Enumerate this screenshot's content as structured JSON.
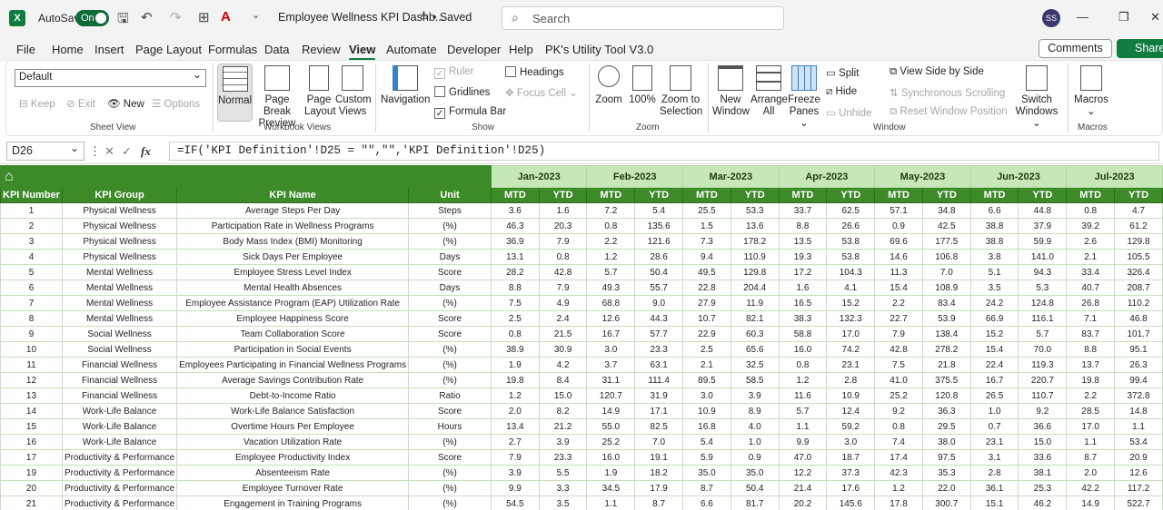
{
  "titlebar": {
    "app_logo": "X",
    "autosave_label": "AutoSave",
    "autosave_state": "On",
    "doc_title": "Employee Wellness KPI Dashb...",
    "saved_status": "• Saved",
    "search_placeholder": "Search",
    "user_initials": "SS"
  },
  "menu": {
    "items": [
      "File",
      "Home",
      "Insert",
      "Page Layout",
      "Formulas",
      "Data",
      "Review",
      "View",
      "Automate",
      "Developer",
      "Help",
      "PK's Utility Tool V3.0"
    ],
    "active": "View",
    "comments": "Comments",
    "share": "Share"
  },
  "ribbon": {
    "sheet_view": {
      "dropdown_value": "Default",
      "keep": "Keep",
      "exit": "Exit",
      "new": "New",
      "options": "Options",
      "label": "Sheet View"
    },
    "workbook_views": {
      "normal": "Normal",
      "page_break_1": "Page Break",
      "page_break_2": "Preview",
      "page_layout_1": "Page",
      "page_layout_2": "Layout",
      "custom_1": "Custom",
      "custom_2": "Views",
      "label": "Workbook Views"
    },
    "show": {
      "navigation": "Navigation",
      "ruler": "Ruler",
      "gridlines": "Gridlines",
      "formula_bar": "Formula Bar",
      "headings": "Headings",
      "focus_cell": "Focus Cell",
      "label": "Show"
    },
    "zoom": {
      "zoom": "Zoom",
      "hundred": "100%",
      "sel_1": "Zoom to",
      "sel_2": "Selection",
      "label": "Zoom"
    },
    "window": {
      "new_1": "New",
      "new_2": "Window",
      "arrange_1": "Arrange",
      "arrange_2": "All",
      "freeze_1": "Freeze",
      "freeze_2": "Panes",
      "split": "Split",
      "hide": "Hide",
      "unhide": "Unhide",
      "side_by_side": "View Side by Side",
      "sync_scroll": "Synchronous Scrolling",
      "reset_pos": "Reset Window Position",
      "switch_1": "Switch",
      "switch_2": "Windows",
      "label": "Window"
    },
    "macros": {
      "macros": "Macros",
      "label": "Macros"
    }
  },
  "formula_bar": {
    "cell_ref": "D26",
    "fx": "fx",
    "formula": "=IF('KPI Definition'!D25 = \"\",\"\",'KPI Definition'!D25)"
  },
  "sheet": {
    "months": [
      "Jan-2023",
      "Feb-2023",
      "Mar-2023",
      "Apr-2023",
      "May-2023",
      "Jun-2023",
      "Jul-2023"
    ],
    "headers": [
      "KPI Number",
      "KPI Group",
      "KPI Name",
      "Unit"
    ],
    "sub_headers": [
      "MTD",
      "YTD"
    ],
    "rows": [
      [
        "1",
        "Physical Wellness",
        "Average Steps Per Day",
        "Steps",
        "3.6",
        "1.6",
        "7.2",
        "5.4",
        "25.5",
        "53.3",
        "33.7",
        "62.5",
        "57.1",
        "34.8",
        "6.6",
        "44.8",
        "0.8",
        "4.7"
      ],
      [
        "2",
        "Physical Wellness",
        "Participation Rate in Wellness Programs",
        "(%)",
        "46.3",
        "20.3",
        "0.8",
        "135.6",
        "1.5",
        "13.6",
        "8.8",
        "26.6",
        "0.9",
        "42.5",
        "38.8",
        "37.9",
        "39.2",
        "61.2"
      ],
      [
        "3",
        "Physical Wellness",
        "Body Mass Index (BMI) Monitoring",
        "(%)",
        "36.9",
        "7.9",
        "2.2",
        "121.6",
        "7.3",
        "178.2",
        "13.5",
        "53.8",
        "69.6",
        "177.5",
        "38.8",
        "59.9",
        "2.6",
        "129.8"
      ],
      [
        "4",
        "Physical Wellness",
        "Sick Days Per Employee",
        "Days",
        "13.1",
        "0.8",
        "1.2",
        "28.6",
        "9.4",
        "110.9",
        "19.3",
        "53.8",
        "14.6",
        "106.8",
        "3.8",
        "141.0",
        "2.1",
        "105.5"
      ],
      [
        "5",
        "Mental Wellness",
        "Employee Stress Level Index",
        "Score",
        "28.2",
        "42.8",
        "5.7",
        "50.4",
        "49.5",
        "129.8",
        "17.2",
        "104.3",
        "11.3",
        "7.0",
        "5.1",
        "94.3",
        "33.4",
        "326.4"
      ],
      [
        "6",
        "Mental Wellness",
        "Mental Health Absences",
        "Days",
        "8.8",
        "7.9",
        "49.3",
        "55.7",
        "22.8",
        "204.4",
        "1.6",
        "4.1",
        "15.4",
        "108.9",
        "3.5",
        "5.3",
        "40.7",
        "208.7"
      ],
      [
        "7",
        "Mental Wellness",
        "Employee Assistance Program (EAP) Utilization Rate",
        "(%)",
        "7.5",
        "4.9",
        "68.8",
        "9.0",
        "27.9",
        "11.9",
        "16.5",
        "15.2",
        "2.2",
        "83.4",
        "24.2",
        "124.8",
        "26.8",
        "110.2"
      ],
      [
        "8",
        "Mental Wellness",
        "Employee Happiness Score",
        "Score",
        "2.5",
        "2.4",
        "12.6",
        "44.3",
        "10.7",
        "82.1",
        "38.3",
        "132.3",
        "22.7",
        "53.9",
        "66.9",
        "116.1",
        "7.1",
        "46.8"
      ],
      [
        "9",
        "Social Wellness",
        "Team Collaboration Score",
        "Score",
        "0.8",
        "21.5",
        "16.7",
        "57.7",
        "22.9",
        "60.3",
        "58.8",
        "17.0",
        "7.9",
        "138.4",
        "15.2",
        "5.7",
        "83.7",
        "101.7"
      ],
      [
        "10",
        "Social Wellness",
        "Participation in Social Events",
        "(%)",
        "38.9",
        "30.9",
        "3.0",
        "23.3",
        "2.5",
        "65.6",
        "16.0",
        "74.2",
        "42.8",
        "278.2",
        "15.4",
        "70.0",
        "8.8",
        "95.1"
      ],
      [
        "11",
        "Financial Wellness",
        "Employees Participating in Financial Wellness Programs",
        "(%)",
        "1.9",
        "4.2",
        "3.7",
        "63.1",
        "2.1",
        "32.5",
        "0.8",
        "23.1",
        "7.5",
        "21.8",
        "22.4",
        "119.3",
        "13.7",
        "26.3"
      ],
      [
        "12",
        "Financial Wellness",
        "Average Savings Contribution Rate",
        "(%)",
        "19.8",
        "8.4",
        "31.1",
        "111.4",
        "89.5",
        "58.5",
        "1.2",
        "2.8",
        "41.0",
        "375.5",
        "16.7",
        "220.7",
        "19.8",
        "99.4"
      ],
      [
        "13",
        "Financial Wellness",
        "Debt-to-Income Ratio",
        "Ratio",
        "1.2",
        "15.0",
        "120.7",
        "31.9",
        "3.0",
        "3.9",
        "11.6",
        "10.9",
        "25.2",
        "120.8",
        "26.5",
        "110.7",
        "2.2",
        "372.8"
      ],
      [
        "14",
        "Work-Life Balance",
        "Work-Life Balance Satisfaction",
        "Score",
        "2.0",
        "8.2",
        "14.9",
        "17.1",
        "10.9",
        "8.9",
        "5.7",
        "12.4",
        "9.2",
        "36.3",
        "1.0",
        "9.2",
        "28.5",
        "14.8"
      ],
      [
        "15",
        "Work-Life Balance",
        "Overtime Hours Per Employee",
        "Hours",
        "13.4",
        "21.2",
        "55.0",
        "82.5",
        "16.8",
        "4.0",
        "1.1",
        "59.2",
        "0.8",
        "29.5",
        "0.7",
        "36.6",
        "17.0",
        "1.1"
      ],
      [
        "16",
        "Work-Life Balance",
        "Vacation Utilization Rate",
        "(%)",
        "2.7",
        "3.9",
        "25.2",
        "7.0",
        "5.4",
        "1.0",
        "9.9",
        "3.0",
        "7.4",
        "38.0",
        "23.1",
        "15.0",
        "1.1",
        "53.4"
      ],
      [
        "17",
        "Productivity & Performance",
        "Employee Productivity Index",
        "Score",
        "7.9",
        "23.3",
        "16.0",
        "19.1",
        "5.9",
        "0.9",
        "47.0",
        "18.7",
        "17.4",
        "97.5",
        "3.1",
        "33.6",
        "8.7",
        "20.9"
      ],
      [
        "19",
        "Productivity & Performance",
        "Absenteeism Rate",
        "(%)",
        "3.9",
        "5.5",
        "1.9",
        "18.2",
        "35.0",
        "35.0",
        "12.2",
        "37.3",
        "42.3",
        "35.3",
        "2.8",
        "38.1",
        "2.0",
        "12.6"
      ],
      [
        "20",
        "Productivity & Performance",
        "Employee Turnover Rate",
        "(%)",
        "9.9",
        "3.3",
        "34.5",
        "17.9",
        "8.7",
        "50.4",
        "21.4",
        "17.6",
        "1.2",
        "22.0",
        "36.1",
        "25.3",
        "42.2",
        "117.2"
      ],
      [
        "21",
        "Productivity & Performance",
        "Engagement in Training Programs",
        "(%)",
        "54.5",
        "3.5",
        "1.1",
        "8.7",
        "6.6",
        "81.7",
        "20.2",
        "145.6",
        "17.8",
        "300.7",
        "15.1",
        "46.2",
        "14.9",
        "522.7"
      ]
    ]
  }
}
